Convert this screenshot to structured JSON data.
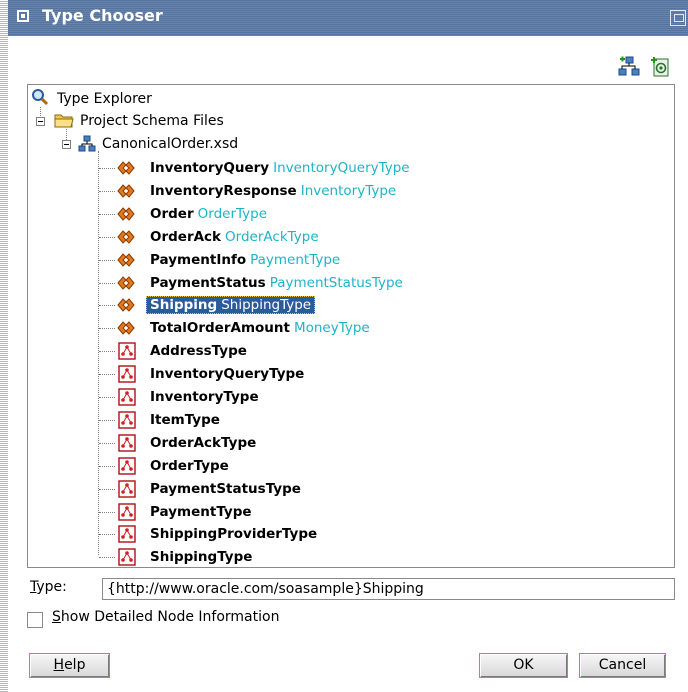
{
  "window": {
    "title": "Type Chooser"
  },
  "toolbar": {
    "icons": [
      "add-schema-icon",
      "import-schema-icon"
    ]
  },
  "tree": {
    "root_label": "Type Explorer",
    "project_label": "Project Schema Files",
    "file_label": "CanonicalOrder.xsd",
    "elements": [
      {
        "name": "InventoryQuery",
        "type": "InventoryQueryType"
      },
      {
        "name": "InventoryResponse",
        "type": "InventoryType"
      },
      {
        "name": "Order",
        "type": "OrderType"
      },
      {
        "name": "OrderAck",
        "type": "OrderAckType"
      },
      {
        "name": "PaymentInfo",
        "type": "PaymentType"
      },
      {
        "name": "PaymentStatus",
        "type": "PaymentStatusType"
      },
      {
        "name": "Shipping",
        "type": "ShippingType",
        "selected": true
      },
      {
        "name": "TotalOrderAmount",
        "type": "MoneyType"
      }
    ],
    "complex_types": [
      "AddressType",
      "InventoryQueryType",
      "InventoryType",
      "ItemType",
      "OrderAckType",
      "OrderType",
      "PaymentStatusType",
      "PaymentType",
      "ShippingProviderType",
      "ShippingType"
    ]
  },
  "type_field": {
    "label_prefix": "T",
    "label_rest": "ype:",
    "value": "{http://www.oracle.com/soasample}Shipping"
  },
  "checkbox": {
    "label_prefix": "S",
    "label_rest": "how Detailed Node Information",
    "checked": false
  },
  "buttons": {
    "help_prefix": "H",
    "help_rest": "elp",
    "ok": "OK",
    "cancel": "Cancel"
  },
  "colors": {
    "title_bar": "#5a79a6",
    "type_text": "#1fb3c8",
    "selection": "#2a5b9b"
  }
}
